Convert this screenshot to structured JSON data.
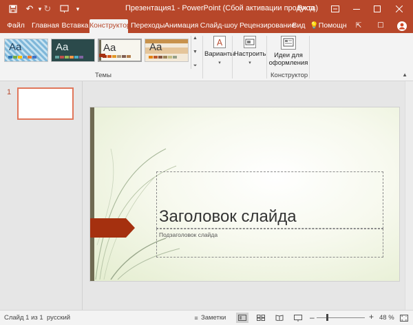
{
  "window": {
    "title": "Презентация1  -  PowerPoint (Сбой активации продукта)",
    "login_label": "Вход",
    "accent_color": "#b7472a"
  },
  "quick_access": {
    "icons": [
      "save-icon",
      "undo-icon",
      "redo-icon",
      "start-slideshow-icon",
      "customize-icon"
    ]
  },
  "tabs": [
    {
      "label": "Файл"
    },
    {
      "label": "Главная"
    },
    {
      "label": "Вставка"
    },
    {
      "label": "Конструктор",
      "active": true
    },
    {
      "label": "Переходы"
    },
    {
      "label": "Анимация"
    },
    {
      "label": "Слайд-шоу"
    },
    {
      "label": "Рецензирование"
    },
    {
      "label": "Вид"
    }
  ],
  "tell_me": {
    "label": "Помощн"
  },
  "ribbon": {
    "themes_group_label": "Темы",
    "theme_glyph": "Aa",
    "variants_label": "Варианты",
    "customize_label": "Настроить",
    "design_ideas_label_1": "Идеи для",
    "design_ideas_label_2": "оформления",
    "designer_group_label": "Конструктор"
  },
  "thumbnails": [
    {
      "number": "1"
    }
  ],
  "slide": {
    "title_placeholder": "Заголовок слайда",
    "subtitle_placeholder": "Подзаголовок слайда"
  },
  "status": {
    "slide_counter": "Слайд 1 из 1",
    "language": "русский",
    "notes_label": "Заметки",
    "zoom_minus": "–",
    "zoom_plus": "+",
    "zoom_value": "48 %",
    "zoom_level_percent": 48
  }
}
